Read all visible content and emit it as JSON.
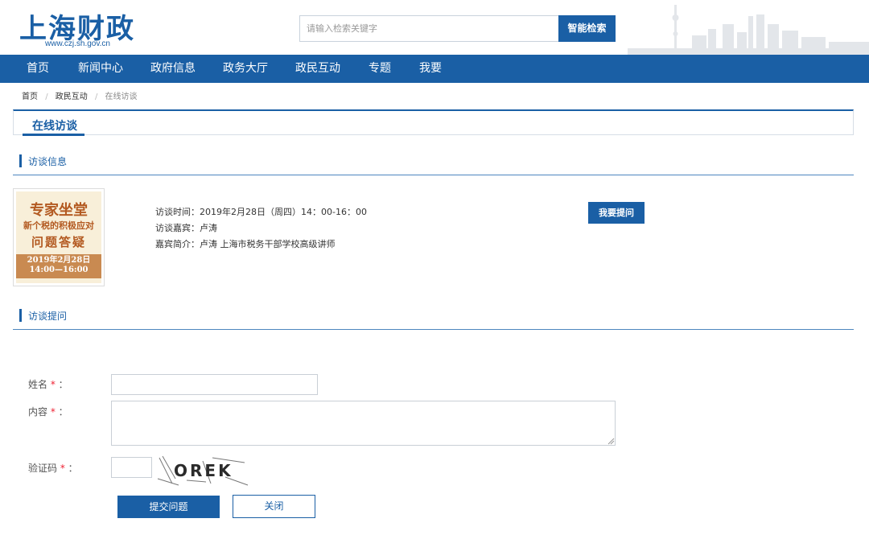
{
  "header": {
    "logo_text": "上海财政",
    "logo_url": "www.czj.sh.gov.cn",
    "search_placeholder": "请输入检索关键字",
    "search_button": "智能检索"
  },
  "nav": {
    "items": [
      "首页",
      "新闻中心",
      "政府信息",
      "政务大厅",
      "政民互动",
      "专题",
      "我要"
    ]
  },
  "breadcrumb": {
    "items": [
      "首页",
      "政民互动",
      "在线访谈"
    ],
    "separator": "/"
  },
  "page": {
    "title": "在线访谈"
  },
  "interview_info": {
    "section_title": "访谈信息",
    "poster": {
      "line1": "专家坐堂",
      "line2": "新个税的积极应对",
      "line3": "问题答疑",
      "date": "2019年2月28日",
      "time": "14:00—16:00"
    },
    "time_line": "访谈时间：2019年2月28日（周四）14：00-16：00",
    "guest_line": "访谈嘉宾：卢涛",
    "bio_line": "嘉宾简介：卢涛 上海市税务干部学校高级讲师",
    "ask_button": "我要提问"
  },
  "question_form": {
    "section_title": "访谈提问",
    "name_label": "姓名",
    "content_label": "内容",
    "captcha_label": "验证码",
    "required_mark": "*",
    "colon": "：",
    "captcha_text": "OREK",
    "submit_button": "提交问题",
    "close_button": "关闭"
  },
  "colors": {
    "brand_blue": "#1a5fa5",
    "required_red": "#e23333",
    "poster_bg": "#f8efd9",
    "poster_text": "#b35a21"
  }
}
